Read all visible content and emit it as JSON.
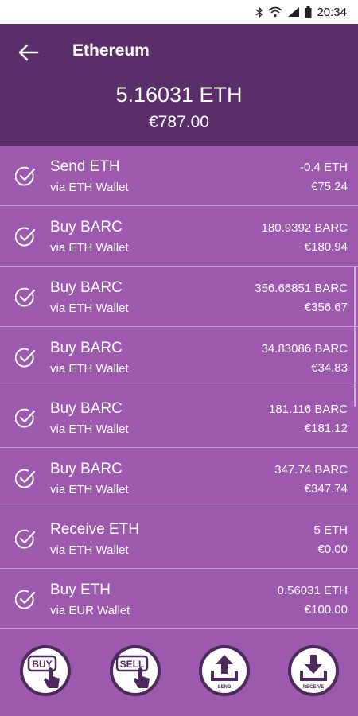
{
  "status_bar": {
    "time": "20:34"
  },
  "header": {
    "title": "Ethereum",
    "balance": "5.16031 ETH",
    "fiat_balance": "€787.00"
  },
  "transactions": [
    {
      "title": "Send ETH",
      "via": "via ETH Wallet",
      "amount": "-0.4 ETH",
      "value": "€75.24"
    },
    {
      "title": "Buy BARC",
      "via": "via ETH Wallet",
      "amount": "180.9392 BARC",
      "value": "€180.94"
    },
    {
      "title": "Buy BARC",
      "via": "via ETH Wallet",
      "amount": "356.66851 BARC",
      "value": "€356.67"
    },
    {
      "title": "Buy BARC",
      "via": "via ETH Wallet",
      "amount": "34.83086 BARC",
      "value": "€34.83"
    },
    {
      "title": "Buy BARC",
      "via": "via ETH Wallet",
      "amount": "181.116 BARC",
      "value": "€181.12"
    },
    {
      "title": "Buy BARC",
      "via": "via ETH Wallet",
      "amount": "347.74 BARC",
      "value": "€347.74"
    },
    {
      "title": "Receive ETH",
      "via": "via ETH Wallet",
      "amount": "5 ETH",
      "value": "€0.00"
    },
    {
      "title": "Buy ETH",
      "via": "via EUR Wallet",
      "amount": "0.56031 ETH",
      "value": "€100.00"
    }
  ],
  "actions": {
    "buy_label": "BUY",
    "sell_label": "SELL",
    "send_label": "SEND",
    "receive_label": "RECEIVE"
  },
  "colors": {
    "header_bg": "#5a2f69",
    "list_bg": "#9c59ad",
    "divider": "#c9a3d3",
    "action_dark": "#4e2a5c"
  }
}
